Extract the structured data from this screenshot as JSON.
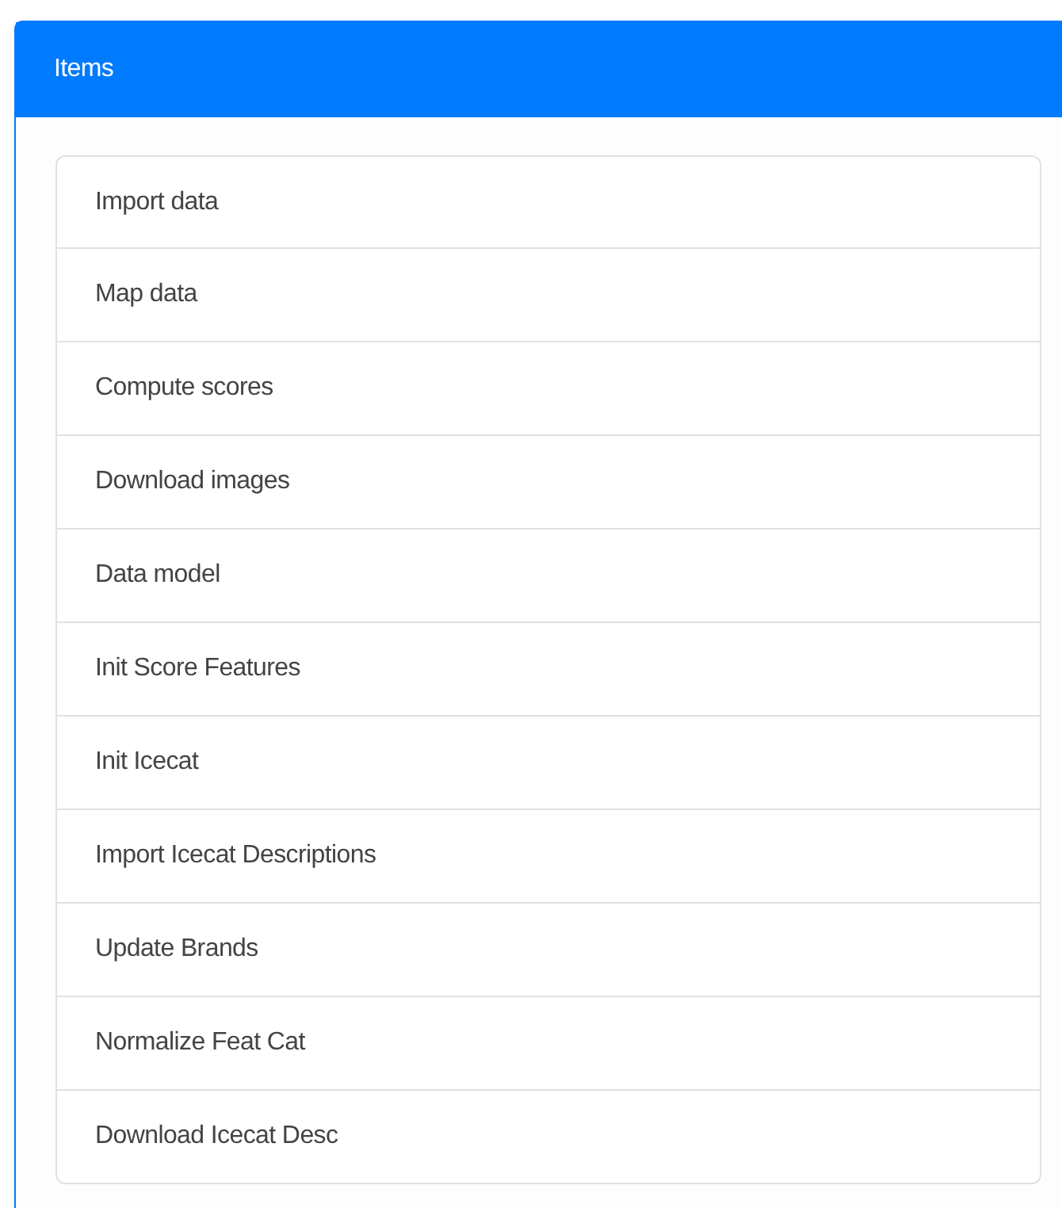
{
  "panel": {
    "title": "Items"
  },
  "items": [
    "Import data",
    "Map data",
    "Compute scores",
    "Download images",
    "Data model",
    "Init Score Features",
    "Init Icecat",
    "Import Icecat Descriptions",
    "Update Brands",
    "Normalize Feat Cat",
    "Download Icecat Desc"
  ]
}
